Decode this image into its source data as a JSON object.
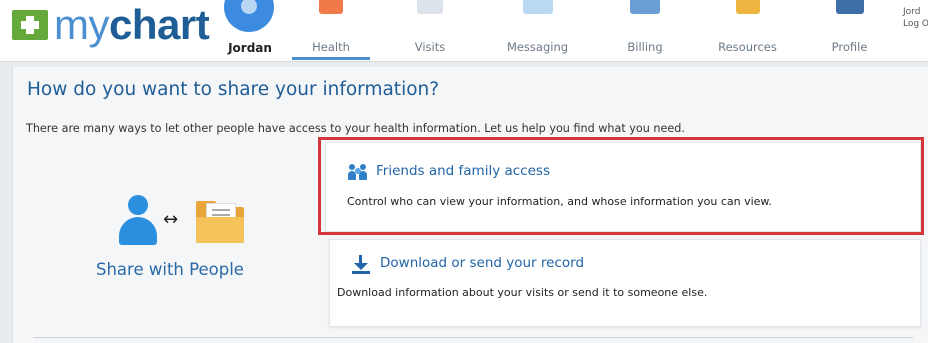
{
  "header": {
    "logo": {
      "my": "my",
      "chart": "chart"
    },
    "user_name": "Jordan",
    "account_text": "Jord\nLog O",
    "nav": [
      {
        "label": "Health",
        "icon": "health-icon",
        "active": true
      },
      {
        "label": "Visits",
        "icon": "visits-icon"
      },
      {
        "label": "Messaging",
        "icon": "messaging-icon"
      },
      {
        "label": "Billing",
        "icon": "billing-icon"
      },
      {
        "label": "Resources",
        "icon": "resources-icon"
      },
      {
        "label": "Profile",
        "icon": "profile-icon"
      }
    ]
  },
  "main": {
    "title": "How do you want to share your information?",
    "intro": "There are many ways to let other people have access to your health information. Let us help you find what you need.",
    "share_label": "Share with People",
    "options": [
      {
        "title": "Friends and family access",
        "description": "Control who can view your information, and whose information you can view.",
        "icon": "friends-family-icon",
        "highlighted": true
      },
      {
        "title": "Download or send your record",
        "description": "Download information about your visits or send it to someone else.",
        "icon": "download-icon"
      }
    ]
  },
  "colors": {
    "brand_blue": "#1f5d96",
    "link_blue": "#2164a8",
    "brand_green": "#66a93b",
    "highlight_red": "#d4373b"
  }
}
